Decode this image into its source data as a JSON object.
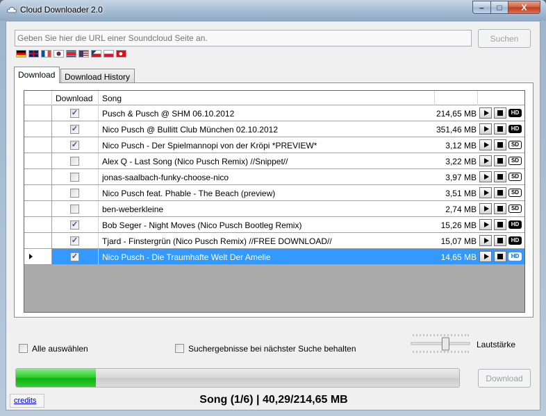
{
  "window": {
    "title": "Cloud Downloader 2.0",
    "min_glyph": "–",
    "max_glyph": "□",
    "close_glyph": "X"
  },
  "url_input": {
    "placeholder": "Geben Sie hier die URL einer Soundcloud Seite an."
  },
  "search_label": "Suchen",
  "flags": [
    "germany-flag",
    "uk-flag",
    "france-flag",
    "south-korea-flag",
    "north-korea-flag",
    "usa-flag",
    "czech-flag",
    "poland-flag",
    "turkey-flag"
  ],
  "tabs": [
    {
      "label": "Download",
      "active": true
    },
    {
      "label": "Download History",
      "active": false
    }
  ],
  "grid": {
    "columns": {
      "download": "Download",
      "song": "Song"
    },
    "rows": [
      {
        "checked": true,
        "song": "Pusch & Pusch @ SHM 06.10.2012",
        "size": "214,65 MB",
        "quality": "HD"
      },
      {
        "checked": true,
        "song": "Nico Pusch @ Bullitt Club München 02.10.2012",
        "size": "351,46 MB",
        "quality": "HD"
      },
      {
        "checked": true,
        "song": "Nico Pusch - Der Spielmannopi von der Kröpi   *PREVIEW*",
        "size": "3,12 MB",
        "quality": "SD"
      },
      {
        "checked": false,
        "song": "Alex Q - Last Song (Nico Pusch Remix)  //Snippet//",
        "size": "3,22 MB",
        "quality": "SD"
      },
      {
        "checked": false,
        "song": "jonas-saalbach-funky-choose-nico",
        "size": "3,97 MB",
        "quality": "SD"
      },
      {
        "checked": false,
        "song": "Nico Pusch feat. Phable - The Beach (preview)",
        "size": "3,51 MB",
        "quality": "SD"
      },
      {
        "checked": false,
        "song": "ben-weberkleine",
        "size": "2,74 MB",
        "quality": "SD"
      },
      {
        "checked": true,
        "song": "Bob Seger - Night Moves (Nico Pusch Bootleg Remix)",
        "size": "15,26 MB",
        "quality": "HD"
      },
      {
        "checked": true,
        "song": "Tjard - Finstergrün (Nico Pusch Remix) //FREE DOWNLOAD//",
        "size": "15,07 MB",
        "quality": "HD"
      },
      {
        "checked": true,
        "song": "Nico Pusch - Die Traumhafte Welt Der Amelie",
        "size": "14,65 MB",
        "quality": "HD",
        "selected": true
      }
    ]
  },
  "select_all_label": "Alle auswählen",
  "keep_results_label": "Suchergebnisse bei nächster Suche behalten",
  "volume_label": "Lautstärke",
  "volume_level": 0.6,
  "progress_fraction": 0.18,
  "download_label": "Download",
  "credits_label": "credits",
  "status_text": "Song (1/6) | 40,29/214,65 MB"
}
